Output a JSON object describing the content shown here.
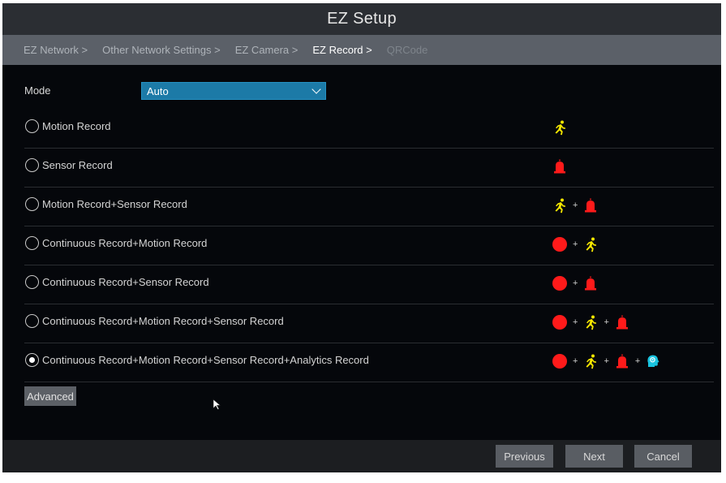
{
  "window": {
    "title": "EZ Setup"
  },
  "breadcrumb": [
    {
      "label": "EZ Network >",
      "state": "normal"
    },
    {
      "label": "Other Network Settings >",
      "state": "normal"
    },
    {
      "label": "EZ Camera >",
      "state": "normal"
    },
    {
      "label": "EZ Record >",
      "state": "active"
    },
    {
      "label": "QRCode",
      "state": "disabled"
    }
  ],
  "mode": {
    "label": "Mode",
    "value": "Auto"
  },
  "options": [
    {
      "label": "Motion Record",
      "checked": false,
      "icons": [
        "motion-icon"
      ]
    },
    {
      "label": "Sensor Record",
      "checked": false,
      "icons": [
        "sensor-alarm-icon"
      ]
    },
    {
      "label": "Motion Record+Sensor Record",
      "checked": false,
      "icons": [
        "motion-icon",
        "sensor-alarm-icon"
      ]
    },
    {
      "label": "Continuous Record+Motion Record",
      "checked": false,
      "icons": [
        "continuous-record-icon",
        "motion-icon"
      ]
    },
    {
      "label": "Continuous Record+Sensor Record",
      "checked": false,
      "icons": [
        "continuous-record-icon",
        "sensor-alarm-icon"
      ]
    },
    {
      "label": "Continuous Record+Motion Record+Sensor Record",
      "checked": false,
      "icons": [
        "continuous-record-icon",
        "motion-icon",
        "sensor-alarm-icon"
      ]
    },
    {
      "label": "Continuous Record+Motion Record+Sensor Record+Analytics Record",
      "checked": true,
      "icons": [
        "continuous-record-icon",
        "motion-icon",
        "sensor-alarm-icon",
        "analytics-icon"
      ]
    }
  ],
  "icon_plus": "+",
  "advanced": {
    "label": "Advanced"
  },
  "footer": {
    "previous_label": "Previous",
    "next_label": "Next",
    "cancel_label": "Cancel"
  },
  "colors": {
    "motion": "#f4e600",
    "sensor": "#ff1a1a",
    "continuous": "#ff1a1a",
    "analytics": "#19c4e0",
    "accent": "#1c7aa7"
  }
}
